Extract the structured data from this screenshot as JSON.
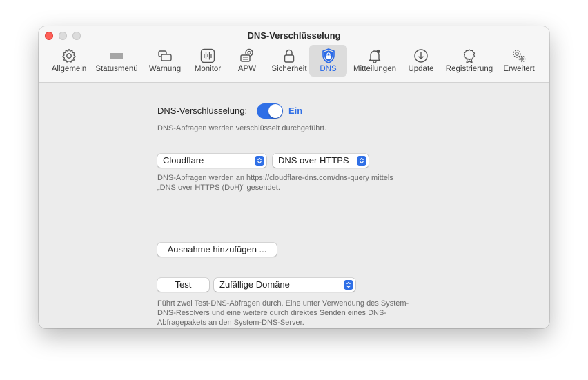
{
  "window": {
    "title": "DNS-Verschlüsselung"
  },
  "toolbar": {
    "items": [
      {
        "label": "Allgemein",
        "icon": "gear-icon"
      },
      {
        "label": "Statusmenü",
        "icon": "menubar-icon"
      },
      {
        "label": "Warnung",
        "icon": "warning-window-icon"
      },
      {
        "label": "Monitor",
        "icon": "monitor-icon"
      },
      {
        "label": "APW",
        "icon": "apw-icon"
      },
      {
        "label": "Sicherheit",
        "icon": "lock-icon"
      },
      {
        "label": "DNS",
        "icon": "dns-shield-lock-icon"
      },
      {
        "label": "Mitteilungen",
        "icon": "bell-icon"
      },
      {
        "label": "Update",
        "icon": "download-circle-icon"
      },
      {
        "label": "Registrierung",
        "icon": "badge-icon"
      },
      {
        "label": "Erweitert",
        "icon": "gears-icon"
      }
    ],
    "active": "DNS"
  },
  "dns": {
    "label": "DNS-Verschlüsselung:",
    "toggle_state": "Ein",
    "toggle_on": true,
    "description": "DNS-Abfragen werden verschlüsselt durchgeführt."
  },
  "provider": {
    "selected": "Cloudflare",
    "protocol": "DNS over HTTPS",
    "description_line1": "DNS-Abfragen werden an https://cloudflare-dns.com/dns-query mittels",
    "description_line2": "„DNS over HTTPS (DoH)“ gesendet."
  },
  "exception": {
    "button_label": "Ausnahme hinzufügen ..."
  },
  "test": {
    "button_label": "Test",
    "domain_selected": "Zufällige Domäne",
    "description_line1": "Führt zwei Test-DNS-Abfragen durch. Eine unter Verwendung des System-",
    "description_line2": "DNS-Resolvers und eine weitere durch direktes Senden eines DNS-",
    "description_line3": "Abfragepakets an den System-DNS-Server."
  },
  "colors": {
    "accent": "#2f6fe6",
    "close": "#fe5f57"
  }
}
